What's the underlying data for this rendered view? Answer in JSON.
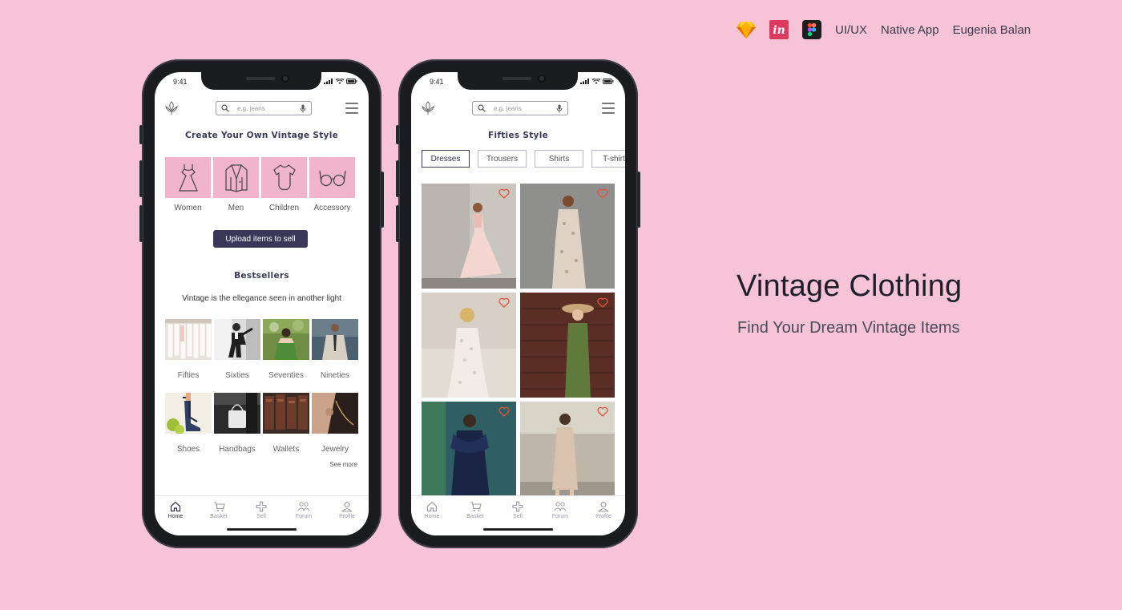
{
  "header": {
    "tools": [
      "sketch-icon",
      "invision-icon",
      "figma-icon"
    ],
    "meta": [
      "UI/UX",
      "Native App",
      "Eugenia Balan"
    ]
  },
  "hero": {
    "title": "Vintage Clothing",
    "subtitle": "Find Your Dream Vintage Items"
  },
  "colors": {
    "background": "#f7c4d7",
    "accent_pink": "#f0b4cb",
    "button_navy": "#3a3758",
    "heart_red": "#e0553a"
  },
  "status": {
    "time": "9:41"
  },
  "search": {
    "placeholder": "e.g. jeans"
  },
  "home": {
    "title": "Create Your Own Vintage Style",
    "categories": [
      {
        "label": "Women",
        "icon": "dress-icon"
      },
      {
        "label": "Men",
        "icon": "jacket-icon"
      },
      {
        "label": "Children",
        "icon": "onesie-icon"
      },
      {
        "label": "Accessory",
        "icon": "glasses-icon"
      }
    ],
    "upload_label": "Upload items to sell",
    "bestsellers_title": "Bestsellers",
    "tagline": "Vintage is the ellegance seen in another light",
    "eras": [
      {
        "label": "Fifties"
      },
      {
        "label": "Sixties"
      },
      {
        "label": "Seventies"
      },
      {
        "label": "Nineties"
      }
    ],
    "accessories": [
      {
        "label": "Shoes"
      },
      {
        "label": "Handbags"
      },
      {
        "label": "Wallets"
      },
      {
        "label": "Jewelry"
      }
    ],
    "see_more": "See more"
  },
  "fifties": {
    "title": "Fifties Style",
    "chips": [
      {
        "label": "Dresses",
        "active": true
      },
      {
        "label": "Trousers",
        "active": false
      },
      {
        "label": "Shirts",
        "active": false
      },
      {
        "label": "T-shirts",
        "active": false
      }
    ],
    "product_count": 6
  },
  "tabbar": {
    "tabs": [
      {
        "label": "Home",
        "icon": "home-icon"
      },
      {
        "label": "Basket",
        "icon": "basket-icon"
      },
      {
        "label": "Sell",
        "icon": "plus-icon"
      },
      {
        "label": "Forum",
        "icon": "forum-icon"
      },
      {
        "label": "Profile",
        "icon": "profile-icon"
      }
    ],
    "active_index": 0
  }
}
